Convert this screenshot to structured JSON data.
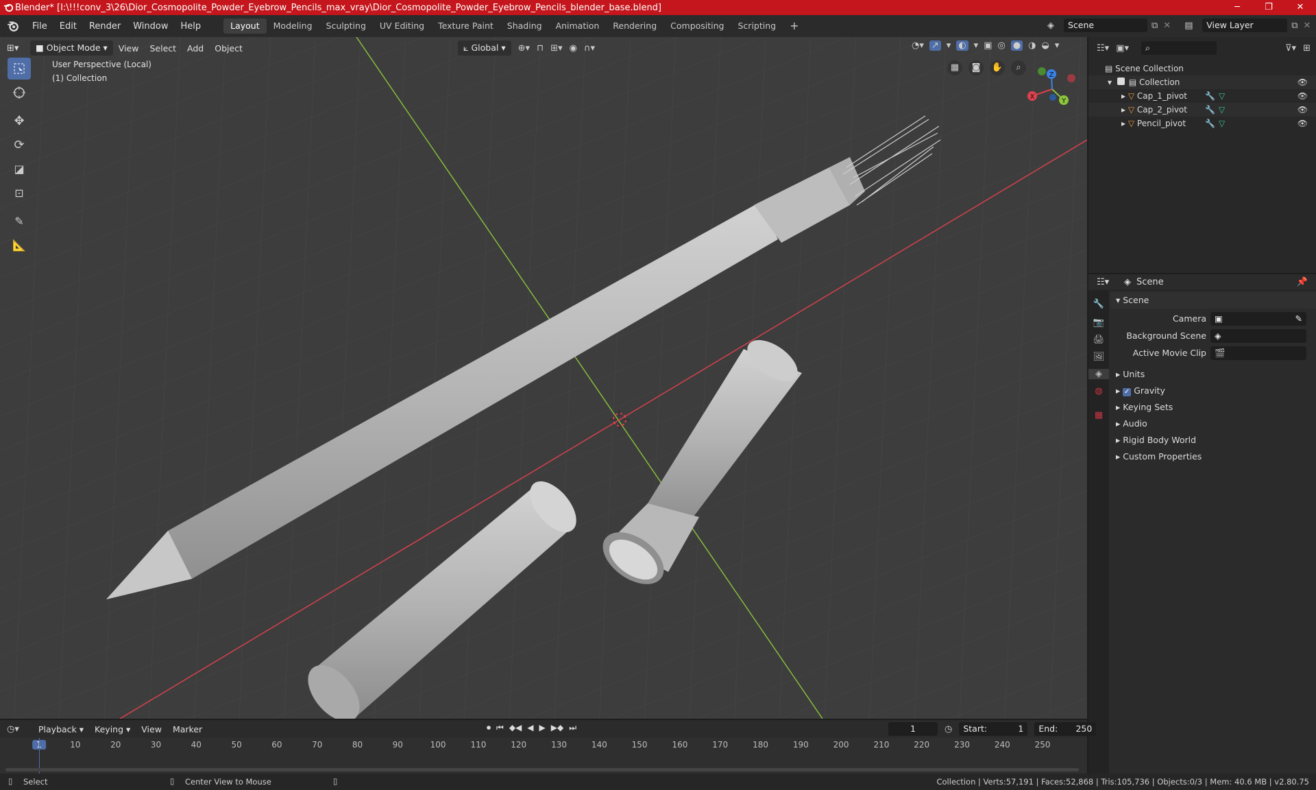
{
  "window": {
    "title": "Blender* [I:\\!!!conv_3\\26\\Dior_Cosmopolite_Powder_Eyebrow_Pencils_max_vray\\Dior_Cosmopolite_Powder_Eyebrow_Pencils_blender_base.blend]",
    "minimize": "─",
    "maximize": "❐",
    "close": "✕"
  },
  "menu": [
    "File",
    "Edit",
    "Render",
    "Window",
    "Help"
  ],
  "workspaces": [
    "Layout",
    "Modeling",
    "Sculpting",
    "UV Editing",
    "Texture Paint",
    "Shading",
    "Animation",
    "Rendering",
    "Compositing",
    "Scripting"
  ],
  "workspace_add": "+",
  "scene_field": "Scene",
  "view_layer_field": "View Layer",
  "viewport": {
    "mode": "Object Mode",
    "menus": [
      "View",
      "Select",
      "Add",
      "Object"
    ],
    "orientation": "Global",
    "perspective": "User Perspective (Local)",
    "collection": "(1) Collection",
    "gizmo": {
      "x": "X",
      "y": "Y",
      "z": "Z"
    }
  },
  "outliner": {
    "search_placeholder": "",
    "root": "Scene Collection",
    "collection": "Collection",
    "objects": [
      "Cap_1_pivot",
      "Cap_2_pivot",
      "Pencil_pivot"
    ]
  },
  "properties": {
    "header": "Scene",
    "panel": "Scene",
    "camera_label": "Camera",
    "bg_label": "Background Scene",
    "clip_label": "Active Movie Clip",
    "sections": [
      "Units",
      "Gravity",
      "Keying Sets",
      "Audio",
      "Rigid Body World",
      "Custom Properties"
    ],
    "gravity_checked": true
  },
  "timeline": {
    "menus": [
      "Playback",
      "Keying",
      "View",
      "Marker"
    ],
    "current_frame": "1",
    "start_label": "Start:",
    "start": "1",
    "end_label": "End:",
    "end": "250",
    "ticks": [
      "1",
      "10",
      "20",
      "30",
      "40",
      "50",
      "60",
      "70",
      "80",
      "90",
      "100",
      "110",
      "120",
      "130",
      "140",
      "150",
      "160",
      "170",
      "180",
      "190",
      "200",
      "210",
      "220",
      "230",
      "240",
      "250"
    ]
  },
  "status": {
    "select": "Select",
    "center": "Center View to Mouse",
    "stats": "Collection | Verts:57,191 | Faces:52,868 | Tris:105,736 | Objects:0/3 | Mem: 40.6 MB | v2.80.75"
  },
  "colors": {
    "accent": "#4f6ea8",
    "titlebar": "#c4161c",
    "x_axis": "#e0414e",
    "y_axis": "#8cc43c",
    "z_axis": "#3b82e6"
  }
}
